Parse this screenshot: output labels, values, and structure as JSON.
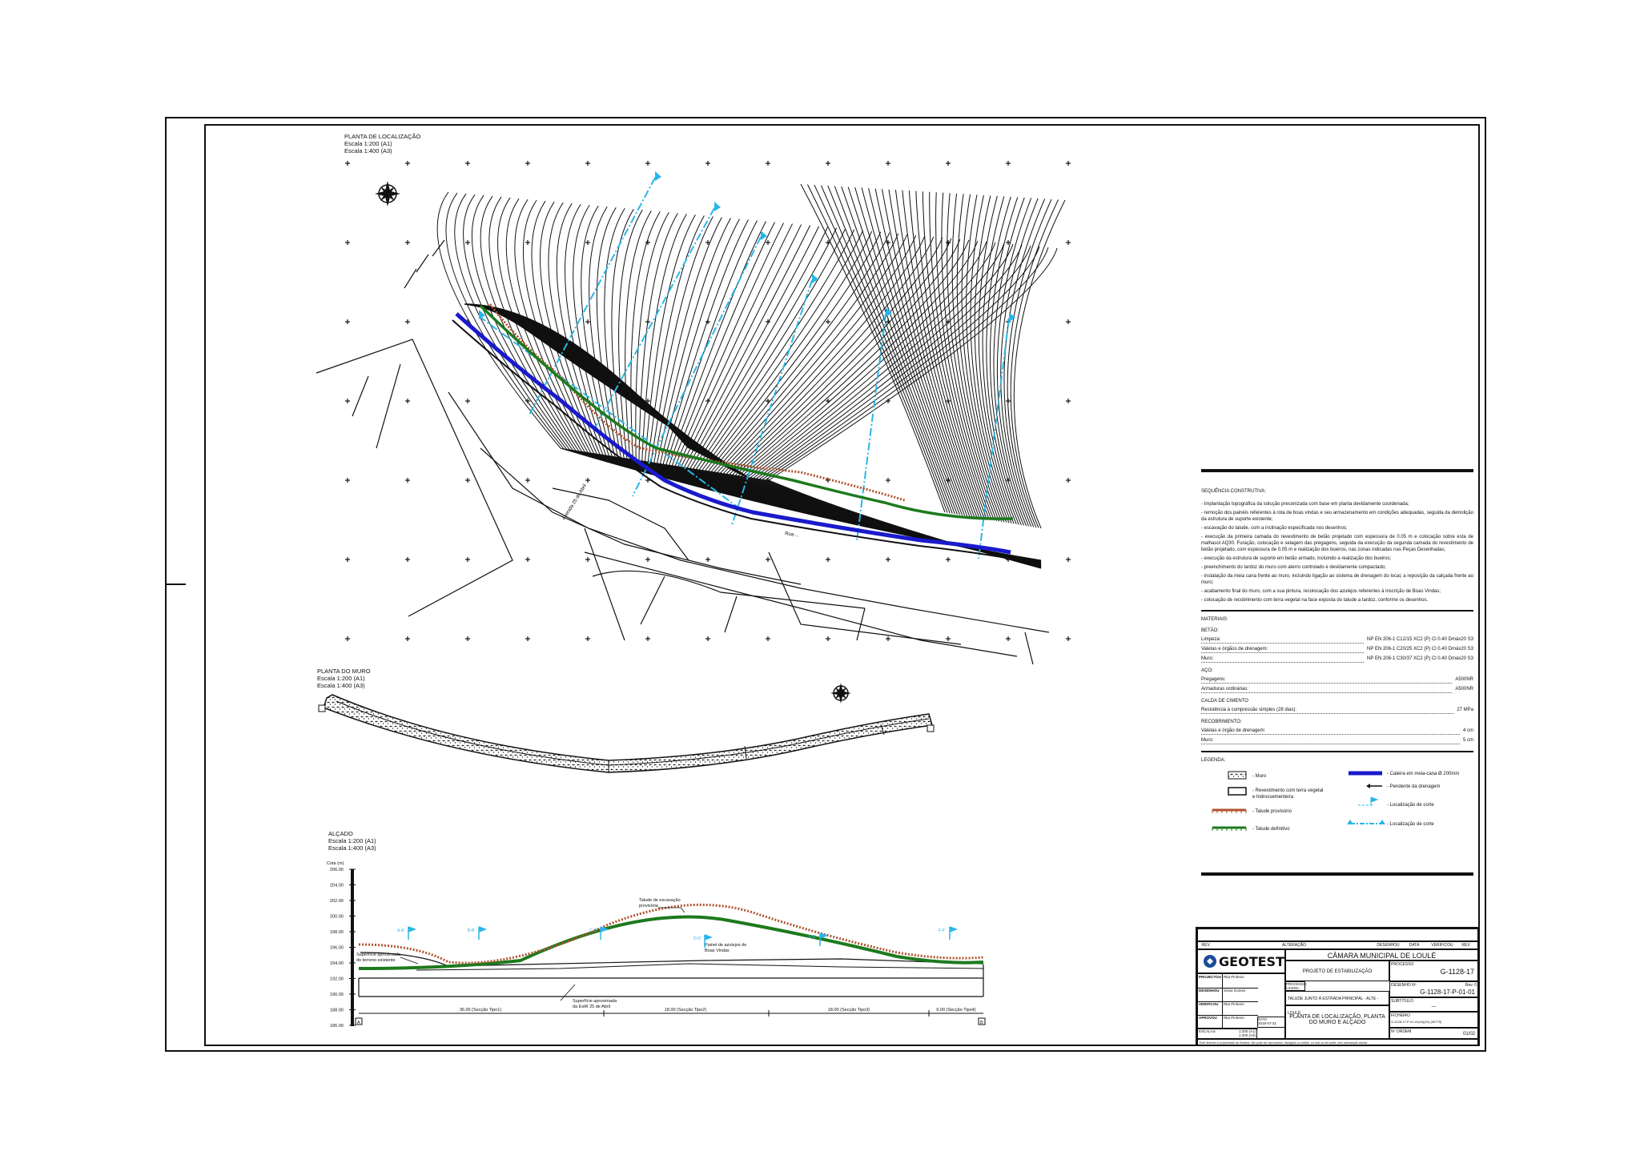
{
  "views": {
    "location": {
      "title": "PLANTA DE LOCALIZAÇÃO",
      "scale_a1": "Escala 1:200 (A1)",
      "scale_a3": "Escala 1:400 (A3)"
    },
    "wall": {
      "title": "PLANTA DO MURO",
      "scale_a1": "Escala 1:200 (A1)",
      "scale_a3": "Escala 1:400 (A3)"
    },
    "elevation": {
      "title": "ALÇADO",
      "scale_a1": "Escala 1:200 (A1)",
      "scale_a3": "Escala 1:400 (A3)",
      "cota_label": "Cota (m)",
      "y_ticks": [
        "206.00",
        "204.00",
        "202.00",
        "200.00",
        "198.00",
        "196.00",
        "194.00",
        "192.00",
        "190.00",
        "188.00",
        "186.00"
      ],
      "section_marks": [
        "A-A'",
        "B-B'",
        "C-C'",
        "D-D'",
        "E-E'",
        "F-F'"
      ],
      "annotations": {
        "provisional_slope": "Talude de escavação provisória",
        "tiles_panel": "Painel de azulejos de Boas Vindas",
        "existing_surface": "Superfície aproximada do terreno existente",
        "road_surface": "Superfície aproximada da EstR 25 de Abril"
      },
      "dimension_labels": [
        "36.00 (Secção Tipo1)",
        "18.00 (Secção Tipo2)",
        "18.00 (Secção Tipo3)",
        "6.00 (Secção Tipo4)"
      ],
      "end_markers": [
        "A",
        "B"
      ]
    }
  },
  "map_labels": {
    "road": "Avenida 25 de Abril",
    "street": "Rua ..."
  },
  "notes": {
    "sequence_title": "SEQUÊNCIA CONSTRUTIVA:",
    "sequence_items": [
      "- Implantação topográfica da solução preconizada com base em planta devidamente coordenada;",
      "- remoção dos painéis referentes à rota de boas vindas e seu armazenamento em condições adequadas, seguida da demolição da estrutura de suporte existente;",
      "- escavação do talude, com a inclinação especificada nos desenhos;",
      "- execução da primeira camada do revestimento de betão projetado com espessura de 0.05 m e colocação sobre esta de malhasol AQ30. Furação, colocação e selagem das pregagens, seguida da execução da segunda camada do revestimento de betão projetado, com espessura de 0.05 m e realização dos bueiros, nas zonas indicadas nas Peças Desenhadas;",
      "- execução da estrutura de suporte em betão armado, incluindo a realização dos bueiros;",
      "- preenchimento do tardoz do muro com aterro controlado e devidamente compactado;",
      "- instalação da meia cana frente ao muro, incluindo ligação ao sistema de drenagem do local, a reposição da calçada frente ao muro;",
      "- acabamento final do muro, com a sua pintura, recolocação dos azulejos referentes à inscrição de Boas Vindas;",
      "- colocação de recobrimento com terra vegetal na face exposta do talude a tardoz, conforme os desenhos."
    ],
    "materials_title": "MATERIAIS:",
    "concrete_title": "BETÃO:",
    "concrete": [
      {
        "label": "Limpeza:",
        "value": "NP EN 206-1 C12/15 XC2 (P) Cl 0.40 Dmáx20 S3"
      },
      {
        "label": "Valetas e órgãos de drenagem:",
        "value": "NP EN 206-1 C20/25 XC2 (P) Cl 0.40 Dmáx20 S3"
      },
      {
        "label": "Muro:",
        "value": "NP EN 206-1 C30/37 XC2 (P) Cl 0.40 Dmáx20 S3"
      }
    ],
    "steel_title": "AÇO:",
    "steel": [
      {
        "label": "Pregagens:",
        "value": "A500NR"
      },
      {
        "label": "Armaduras ordinárias:",
        "value": "A500NR"
      }
    ],
    "grout_title": "CALDA DE CIMENTO",
    "grout": [
      {
        "label": "Resistência à compressão simples (28 dias):",
        "value": "27 MPa"
      }
    ],
    "cover_title": "RECOBRIMENTO:",
    "cover": [
      {
        "label": "Valetas e órgão de drenagem:",
        "value": "4 cm"
      },
      {
        "label": "Muro:",
        "value": "5 cm"
      }
    ],
    "legend_title": "LEGENDA:",
    "legend": {
      "wall": "- Muro",
      "vegetation": "- Revestimento com terra vegetal e hidrossementeira",
      "prov_slope": "- Talude provisório",
      "def_slope": "- Talude definitivo",
      "gutter": "- Caleira em meia-cana Ø 200mm",
      "drain_slope": "- Pendente da drenagem",
      "cut1": "- Localização de corte",
      "cut2": "- Localização de corte"
    }
  },
  "title_block": {
    "rev_headers": [
      "REV.",
      "ALTERAÇÃO",
      "DESENHOU",
      "DATA",
      "VERIFICOU",
      "REV."
    ],
    "client": "CÂMARA MUNICIPAL DE LOULÉ",
    "company": "GEOTEST",
    "project_type": "PROJETO DE ESTABILIZAÇÃO",
    "process_label": "PROCESSO",
    "process_value": "G-1128-17",
    "drawing_label": "DESENHO Nº",
    "rev_label": "Rev. 0",
    "drawing_value": "G-1128-17-P-01-01",
    "subtitle_label": "SUBTÍTULO",
    "subtitle_value": "---",
    "location_text": "TALUDE JUNTO À ESTRADA PRINCIPAL - ALTE - LOULÉ",
    "sheet_title": "PLANTA DE LOCALIZAÇÃO, PLANTA DO MURO E ALÇADO",
    "file_label": "FICHEIRO",
    "file_value": "G-1128-17-P-01-01(v0)(01) (00775)",
    "order_label": "Nº ORDEM",
    "order_value": "01/02",
    "roles": [
      {
        "role": "PROJECTOU",
        "name": "Rita Pinheiro"
      },
      {
        "role": "DESENHOU",
        "name": "Sónia Gomes"
      },
      {
        "role": "VERIFICOU",
        "name": "Rita Pinheiro"
      },
      {
        "role": "APROVOU",
        "name": "Rita Pinheiro"
      }
    ],
    "licence_label": "PROCESSO LICENC.",
    "date_label": "DATA",
    "date_value": "2018-07-31",
    "scales_label": "ESCALAS",
    "scales_values": [
      "1:200 (A1)",
      "1:400 (A3)"
    ],
    "footer": "Este desenho é propriedade da Geotest, não pode ser reproduzido, divulgado ou cedido, no todo ou em parte, sem autorização escrita."
  },
  "colors": {
    "cut_lines": "#29b6e8",
    "gutter": "#1a1acc",
    "def_slope": "#1d7a1d",
    "prov_slope": "#b0522e"
  }
}
